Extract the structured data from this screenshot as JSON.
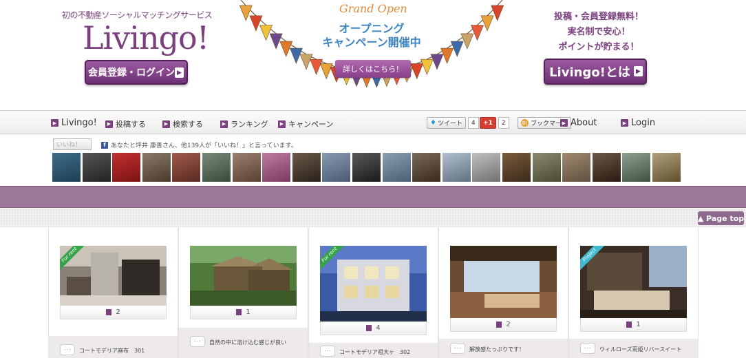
{
  "header": {
    "tagline": "初の不動産ソーシャルマッチングサービス",
    "logo": "Livingo!",
    "signup_label": "会員登録・ログイン",
    "banner_grand": "Grand Open",
    "banner_line1": "オープニング",
    "banner_line2": "キャンペーン開催中",
    "banner_button": "詳しくはこちら！",
    "promo_line1": "投稿・会員登録無料！",
    "promo_line2": "実名制で安心！",
    "promo_line3": "ポイントが貯まる！",
    "about_label": "Livingo!とは",
    "arrow_glyph": "▶"
  },
  "nav": {
    "items": [
      {
        "label": "Livingo!"
      },
      {
        "label": "投稿する"
      },
      {
        "label": "検索する"
      },
      {
        "label": "ランキング"
      },
      {
        "label": "キャンペーン"
      }
    ],
    "tweet_label": "ツイート",
    "tweet_count": "4",
    "gplus_label": "+1",
    "gplus_count": "2",
    "hatena_label": "ブックマーク",
    "about_label": "About",
    "login_label": "Login"
  },
  "social": {
    "like_label": "いいね！",
    "like_text": "あなたと坪井 康善さん、他139人が「いいね！」と言っています。"
  },
  "avatars": [
    {
      "c1": "#3f6e8a",
      "c2": "#1e3d52"
    },
    {
      "c1": "#555555",
      "c2": "#222222"
    },
    {
      "c1": "#c42f2f",
      "c2": "#7a1414"
    },
    {
      "c1": "#8a7a6a",
      "c2": "#4a3a2a"
    },
    {
      "c1": "#a05a4a",
      "c2": "#5a2a22"
    },
    {
      "c1": "#7a8a7a",
      "c2": "#3a4a3a"
    },
    {
      "c1": "#9a8070",
      "c2": "#5a4030"
    },
    {
      "c1": "#c07aa0",
      "c2": "#7a3a60"
    },
    {
      "c1": "#6a5a4a",
      "c2": "#2a2018"
    },
    {
      "c1": "#8a9ab0",
      "c2": "#4a5a70"
    },
    {
      "c1": "#5a5a5a",
      "c2": "#1a1a1a"
    },
    {
      "c1": "#8aa0b0",
      "c2": "#4a6070"
    },
    {
      "c1": "#7a6a5a",
      "c2": "#3a2a1a"
    },
    {
      "c1": "#b0c0d0",
      "c2": "#607080"
    },
    {
      "c1": "#c0c0c0",
      "c2": "#707070"
    },
    {
      "c1": "#7a5a3a",
      "c2": "#3a2a1a"
    },
    {
      "c1": "#8a8a70",
      "c2": "#4a4a30"
    },
    {
      "c1": "#a08a70",
      "c2": "#605040"
    },
    {
      "c1": "#6a5a4a",
      "c2": "#2a1a10"
    },
    {
      "c1": "#90a090",
      "c2": "#405040"
    },
    {
      "c1": "#b0a080",
      "c2": "#605030"
    }
  ],
  "page_top": "▲ Page top",
  "cards": [
    {
      "likes": "2",
      "title": "コートモデリア麻布　301",
      "ribbon": "For rent",
      "ribbon_color": "green"
    },
    {
      "likes": "1",
      "title": "自然の中に溶け込む感じが良い",
      "ribbon": "",
      "ribbon_color": ""
    },
    {
      "likes": "4",
      "title": "コートモデリア祖大ヶ　302",
      "ribbon": "For rent",
      "ribbon_color": "green"
    },
    {
      "likes": "2",
      "title": "解放感たっぷりです！",
      "ribbon": "",
      "ribbon_color": ""
    },
    {
      "likes": "1",
      "title": "ウィルローズ莉姫リバースイート",
      "ribbon": "Project",
      "ribbon_color": "cyan"
    }
  ],
  "bubble_glyph": "･･･",
  "colors": {
    "brand": "#7a3f7e",
    "band": "#9d789b",
    "banner_text": "#3b84c2"
  }
}
